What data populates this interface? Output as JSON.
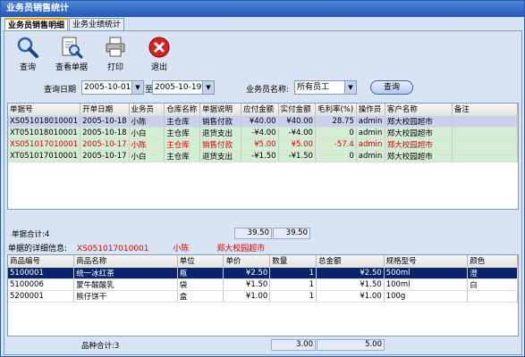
{
  "window": {
    "title": "业务员销售统计"
  },
  "tabs": [
    {
      "label": "业务员销售明细"
    },
    {
      "label": "业务业绩统计"
    }
  ],
  "toolbar": {
    "query": "查询",
    "view": "查看单据",
    "print": "打印",
    "exit": "退出"
  },
  "filter": {
    "date_label": "查询日期",
    "date_from": "2005-10-01",
    "to_label": "至",
    "date_to": "2005-10-19",
    "salesman_label": "业务员名称:",
    "salesman_value": "所有员工",
    "query_button": "查询"
  },
  "orders": {
    "columns": [
      "单据号",
      "开单日期",
      "业务员",
      "仓库名称",
      "单据说明",
      "应付金额",
      "实付金额",
      "毛利率(%)",
      "操作员",
      "客户名称",
      "备注"
    ],
    "rows": [
      [
        "XS051018010001",
        "2005-10-18",
        "小陈",
        "主仓库",
        "销售付款",
        "¥40.00",
        "¥40.00",
        "28.75",
        "admin",
        "郑大校园超市",
        ""
      ],
      [
        "XT051018010001",
        "2005-10-18",
        "小白",
        "主仓库",
        "退货支出",
        "-¥4.00",
        "-¥4.00",
        "0",
        "admin",
        "郑大校园超市",
        ""
      ],
      [
        "XS051017010001",
        "2005-10-17",
        "小陈",
        "主仓库",
        "销售付款",
        "¥5.00",
        "¥5.00",
        "-57.4",
        "admin",
        "郑大校园超市",
        ""
      ],
      [
        "XT051017010001",
        "2005-10-17",
        "小白",
        "主仓库",
        "退货支出",
        "-¥1.50",
        "-¥1.50",
        "0",
        "admin",
        "郑大校园超市",
        ""
      ]
    ],
    "summary_label": "单据合计:4",
    "sum_payable": "39.50",
    "sum_paid": "39.50"
  },
  "detail_info": {
    "label": "单据的详细信息:",
    "doc_no": "XS051017010001",
    "salesman": "小陈",
    "customer": "郑大校园超市"
  },
  "items": {
    "columns": [
      "商品编号",
      "商品名称",
      "单位",
      "单价",
      "数量",
      "总金额",
      "规格型号",
      "颜色"
    ],
    "rows": [
      [
        "5100001",
        "统一冰红茶",
        "瓶",
        "¥2.50",
        "1",
        "¥2.50",
        "500ml",
        "澄"
      ],
      [
        "5100006",
        "蒙牛酸酸乳",
        "袋",
        "¥1.50",
        "1",
        "¥1.50",
        "100ml",
        "白"
      ],
      [
        "5200001",
        "熊仔饼干",
        "盒",
        "¥1.00",
        "1",
        "¥1.00",
        "100g",
        ""
      ]
    ],
    "summary_label": "品种合计:3",
    "sum_qty": "3.00",
    "sum_amount": "5.00"
  }
}
